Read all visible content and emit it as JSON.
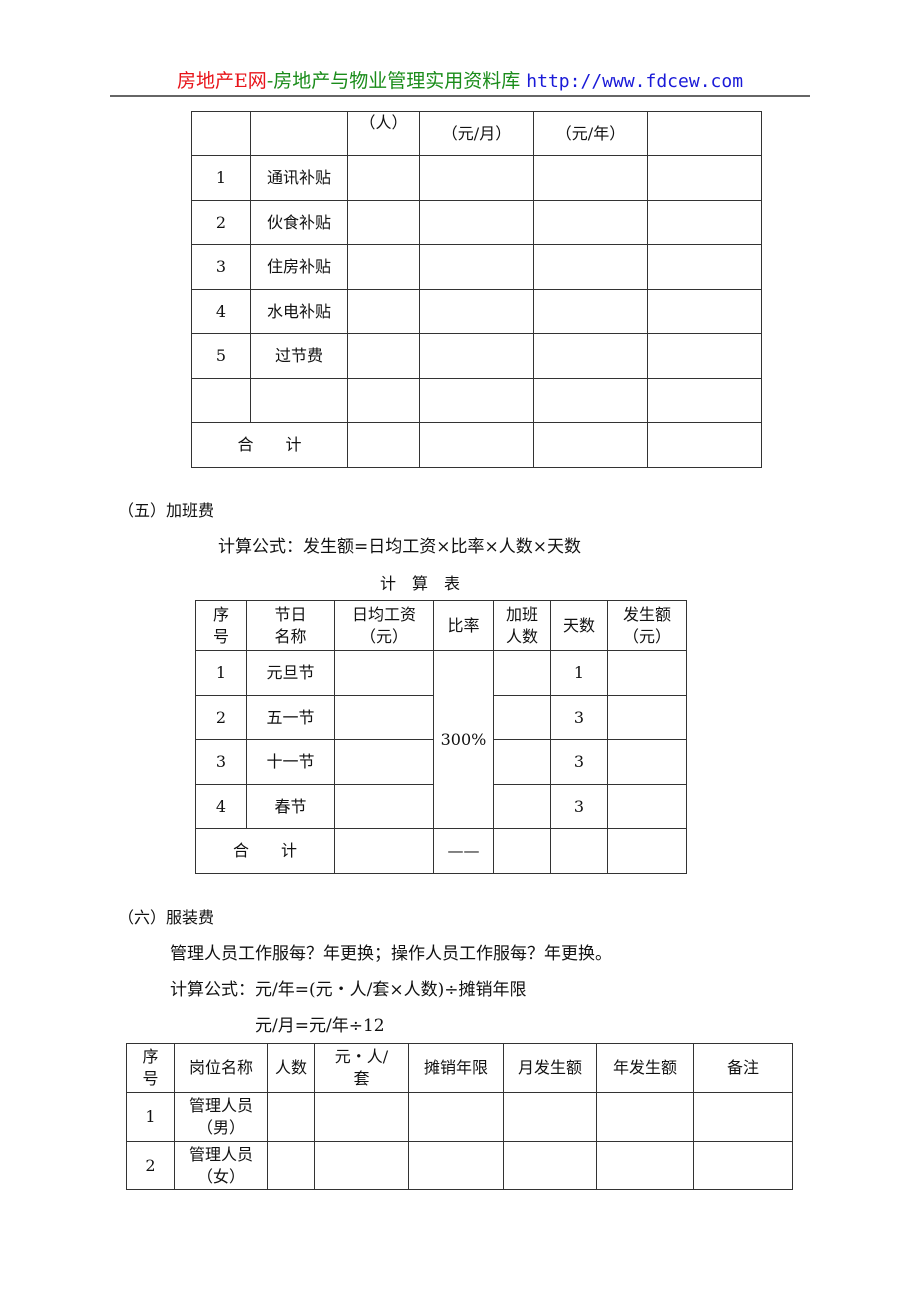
{
  "header": {
    "site_name": "房地产E网",
    "separator": "-",
    "tagline": "房地产与物业管理实用资料库",
    "url": "http://www.fdcew.com",
    "colors": {
      "site_name": "#e8141a",
      "tagline": "#1a8c1a",
      "url": "#1a1ad8"
    }
  },
  "table1": {
    "header_units": [
      "",
      "",
      "（人）",
      "（元/月）",
      "（元/年）",
      ""
    ],
    "rows": [
      {
        "no": "1",
        "item": "通讯补贴"
      },
      {
        "no": "2",
        "item": "伙食补贴"
      },
      {
        "no": "3",
        "item": "住房补贴"
      },
      {
        "no": "4",
        "item": "水电补贴"
      },
      {
        "no": "5",
        "item": "过节费"
      },
      {
        "no": "",
        "item": ""
      }
    ],
    "total_label": "合　　计"
  },
  "section5": {
    "heading": "（五）加班费",
    "formula": "计算公式：发生额=日均工资×比率×人数×天数",
    "table_title": "计　算　表",
    "columns": [
      "序\n号",
      "节日\n名称",
      "日均工资\n（元）",
      "比率",
      "加班\n人数",
      "天数",
      "发生额\n（元）"
    ],
    "col_line1": [
      "序",
      "节日",
      "日均工资",
      "比率",
      "加班",
      "天数",
      "发生额"
    ],
    "col_line2": [
      "号",
      "名称",
      "（元）",
      "",
      "人数",
      "",
      "（元）"
    ],
    "rows": [
      {
        "no": "1",
        "holiday": "元旦节",
        "days": "1"
      },
      {
        "no": "2",
        "holiday": "五一节",
        "days": "3"
      },
      {
        "no": "3",
        "holiday": "十一节",
        "days": "3"
      },
      {
        "no": "4",
        "holiday": "春节",
        "days": "3"
      }
    ],
    "rate": "300%",
    "total_label": "合　　计",
    "total_rate": "——"
  },
  "section6": {
    "heading": "（六）服装费",
    "note": "管理人员工作服每？年更换；操作人员工作服每？年更换。",
    "formula1": "计算公式：元/年=(元・人/套×人数)÷摊销年限",
    "formula2": "元/月=元/年÷12",
    "col_line1": [
      "序",
      "岗位名称",
      "人数",
      "元・人/",
      "摊销年限",
      "月发生额",
      "年发生额",
      "备注"
    ],
    "col_line2": [
      "号",
      "",
      "",
      "套",
      "",
      "",
      "",
      ""
    ],
    "rows": [
      {
        "no": "1",
        "post_line1": "管理人员",
        "post_line2": "（男）"
      },
      {
        "no": "2",
        "post_line1": "管理人员",
        "post_line2": "（女）"
      }
    ]
  }
}
